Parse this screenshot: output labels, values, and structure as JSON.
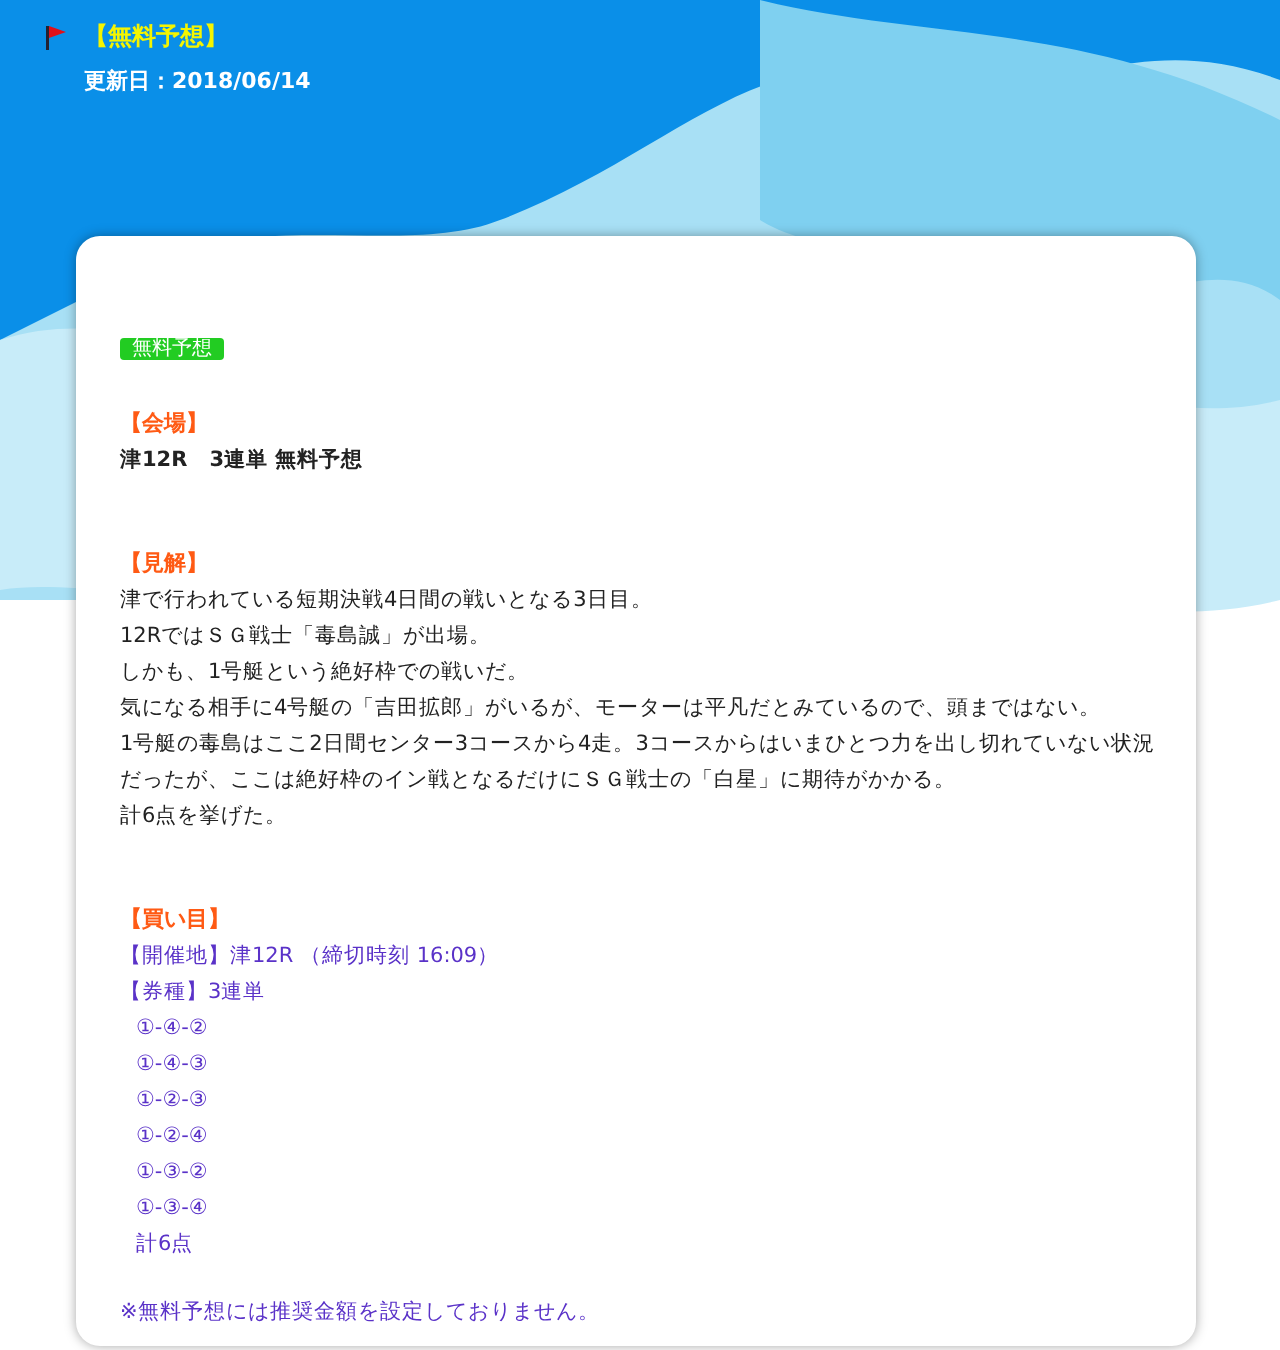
{
  "header": {
    "title": "【無料予想】",
    "updated": "更新日：2018/06/14"
  },
  "card": {
    "badge": "無料予想",
    "sections": [
      {
        "heading": "【会場】",
        "lines": [
          {
            "kind": "bold",
            "text": "津12R　3連単 無料予想"
          }
        ]
      },
      {
        "heading": "【見解】",
        "lines": [
          {
            "kind": "plain",
            "text": "津で行われている短期決戦4日間の戦いとなる3日目。"
          },
          {
            "kind": "plain",
            "text": "12RではＳＧ戦士「毒島誠」が出場。"
          },
          {
            "kind": "plain",
            "text": "しかも、1号艇という絶好枠での戦いだ。"
          },
          {
            "kind": "plain",
            "text": "気になる相手に4号艇の「吉田拡郎」がいるが、モーターは平凡だとみているので、頭まではない。"
          },
          {
            "kind": "plain",
            "text": "1号艇の毒島はここ2日間センター3コースから4走。3コースからはいまひとつ力を出し切れていない状況だったが、ここは絶好枠のイン戦となるだけにＳＧ戦士の「白星」に期待がかかる。"
          },
          {
            "kind": "plain",
            "text": "計6点を挙げた。"
          }
        ]
      },
      {
        "heading": "【買い目】",
        "lines": [
          {
            "kind": "info",
            "text": "【開催地】津12R （締切時刻 16:09）"
          },
          {
            "kind": "info",
            "text": "【券種】3連単"
          },
          {
            "kind": "bet",
            "text": "①-④-②"
          },
          {
            "kind": "bet",
            "text": "①-④-③"
          },
          {
            "kind": "bet",
            "text": "①-②-③"
          },
          {
            "kind": "bet",
            "text": "①-②-④"
          },
          {
            "kind": "bet",
            "text": "①-③-②"
          },
          {
            "kind": "bet",
            "text": "①-③-④"
          },
          {
            "kind": "bet",
            "text": "計6点"
          }
        ]
      }
    ],
    "note": "※無料予想には推奨金額を設定しておりません。"
  }
}
